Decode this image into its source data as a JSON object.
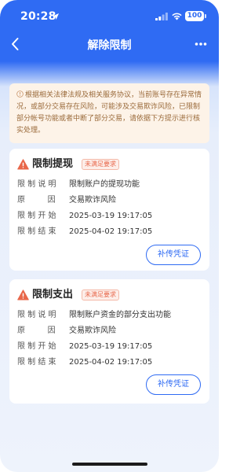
{
  "status_bar": {
    "time": "20:28",
    "battery": "100"
  },
  "nav": {
    "title": "解除限制",
    "back_icon": "chevron-left-icon",
    "more_icon": "more-horizontal-icon"
  },
  "notice": {
    "icon": "info-circle-icon",
    "text": "根据相关法律法规及相关服务协议，当前账号存在异常情况，或部分交易存在风险，可能涉及交易欺诈风险，已限制部分帐号功能或者中断了部分交易，请依据下方提示进行核实处理。"
  },
  "restrictions": [
    {
      "title": "限制提现",
      "badge": "未满足要求",
      "rows": [
        {
          "label": "限制说明",
          "value": "限制账户的提现功能"
        },
        {
          "label": "原因",
          "value": "交易欺诈风险"
        },
        {
          "label": "限制开始",
          "value": "2025-03-19 19:17:05"
        },
        {
          "label": "限制结束",
          "value": "2025-04-02 19:17:05"
        }
      ],
      "button": "补传凭证"
    },
    {
      "title": "限制支出",
      "badge": "未满足要求",
      "rows": [
        {
          "label": "限制说明",
          "value": "限制账户资金的部分支出功能"
        },
        {
          "label": "原因",
          "value": "交易欺诈风险"
        },
        {
          "label": "限制开始",
          "value": "2025-03-19 19:17:05"
        },
        {
          "label": "限制结束",
          "value": "2025-04-02 19:17:05"
        }
      ],
      "button": "补传凭证"
    }
  ],
  "colors": {
    "primary": "#2f6bf3",
    "warning": "#e8674a",
    "notice_bg": "#fdf3e8",
    "notice_text": "#9a6a3a"
  }
}
